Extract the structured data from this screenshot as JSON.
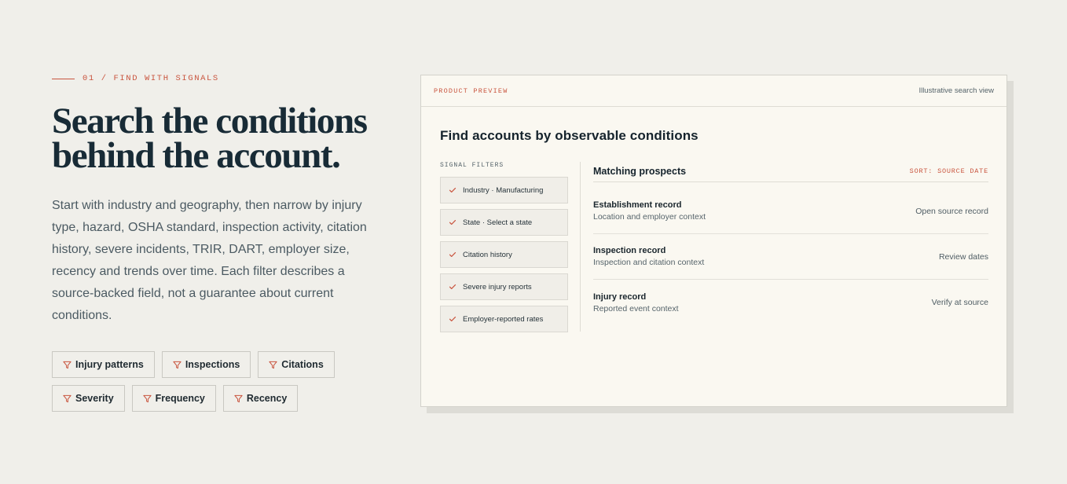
{
  "section": {
    "eyebrow": "01 / FIND WITH SIGNALS",
    "headline_line1": "Search the conditions",
    "headline_line2": "behind the account.",
    "lede": "Start with industry and geography, then narrow by injury type, hazard, OSHA standard, inspection activity, citation history, severe incidents, TRIR, DART, employer size, recency and trends over time. Each filter describes a source-backed field, not a guarantee about current conditions.",
    "chips": [
      {
        "label": "Injury patterns",
        "icon": "filter-icon"
      },
      {
        "label": "Inspections",
        "icon": "filter-icon"
      },
      {
        "label": "Citations",
        "icon": "filter-icon"
      },
      {
        "label": "Severity",
        "icon": "filter-icon"
      },
      {
        "label": "Frequency",
        "icon": "filter-icon"
      },
      {
        "label": "Recency",
        "icon": "filter-icon"
      }
    ]
  },
  "preview": {
    "tag": "PRODUCT PREVIEW",
    "note": "Illustrative search view",
    "title": "Find accounts by observable conditions",
    "filters_label": "SIGNAL FILTERS",
    "filters": [
      {
        "label": "Industry · Manufacturing",
        "icon": "check-icon"
      },
      {
        "label": "State · Select a state",
        "icon": "check-icon"
      },
      {
        "label": "Citation history",
        "icon": "check-icon"
      },
      {
        "label": "Severe injury reports",
        "icon": "check-icon"
      },
      {
        "label": "Employer-reported rates",
        "icon": "check-icon"
      }
    ],
    "results_title": "Matching prospects",
    "sort_label": "SORT: SOURCE DATE",
    "results": [
      {
        "name": "Establishment record",
        "sub": "Location and employer context",
        "action": "Open source record"
      },
      {
        "name": "Inspection record",
        "sub": "Inspection and citation context",
        "action": "Review dates"
      },
      {
        "name": "Injury record",
        "sub": "Reported event context",
        "action": "Verify at source"
      }
    ]
  },
  "colors": {
    "background": "#f0efea",
    "accent": "#c9553f",
    "heading": "#182b36",
    "card": "#faf8f1"
  }
}
